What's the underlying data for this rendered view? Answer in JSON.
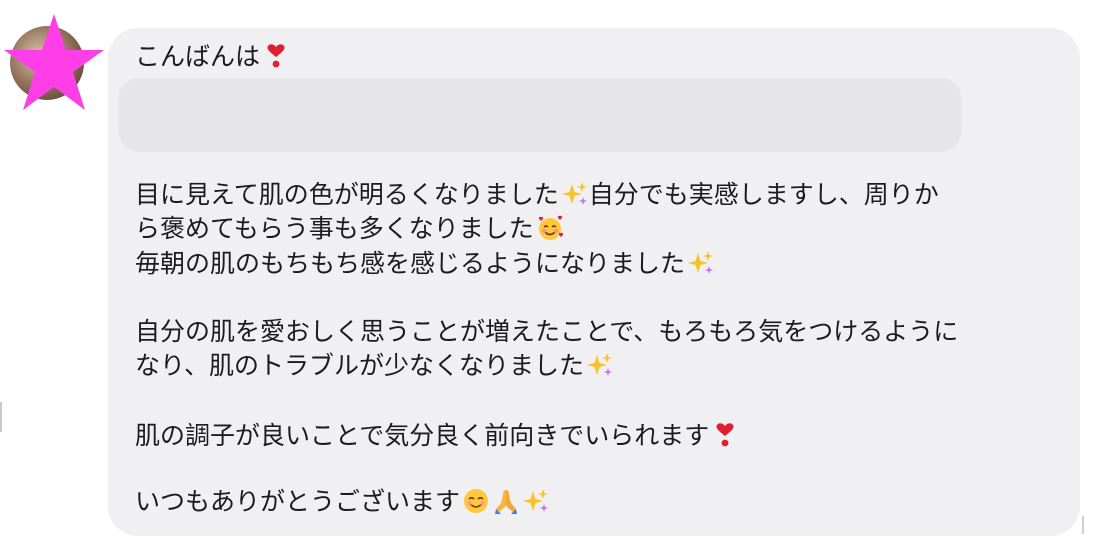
{
  "message": {
    "greeting": "こんばんは",
    "lines": [
      "目に見えて肌の色が明るくなりました",
      "自分でも実感しますし、周りか",
      "ら褒めてもらう事も多くなりました",
      "毎朝の肌のもちもち感を感じるようになりました",
      "自分の肌を愛おしく思うことが増えたことで、もろもろ気をつけるように",
      "なり、肌のトラブルが少なくなりました",
      "肌の調子が良いことで気分良く前向きでいられます",
      "いつもありがとうございます"
    ],
    "emojis": {
      "heart_exclamation": "heart-exclamation-icon",
      "sparkles": "sparkles-icon",
      "smiling_hearts": "smiling-face-with-hearts-icon",
      "smiling_blush": "smiling-face-icon",
      "folded_hands": "folded-hands-icon"
    }
  },
  "colors": {
    "bubble": "#f0f0f2",
    "redacted": "#e6e6e8",
    "text": "#1c1c1e",
    "star": "#ff3ee8"
  }
}
